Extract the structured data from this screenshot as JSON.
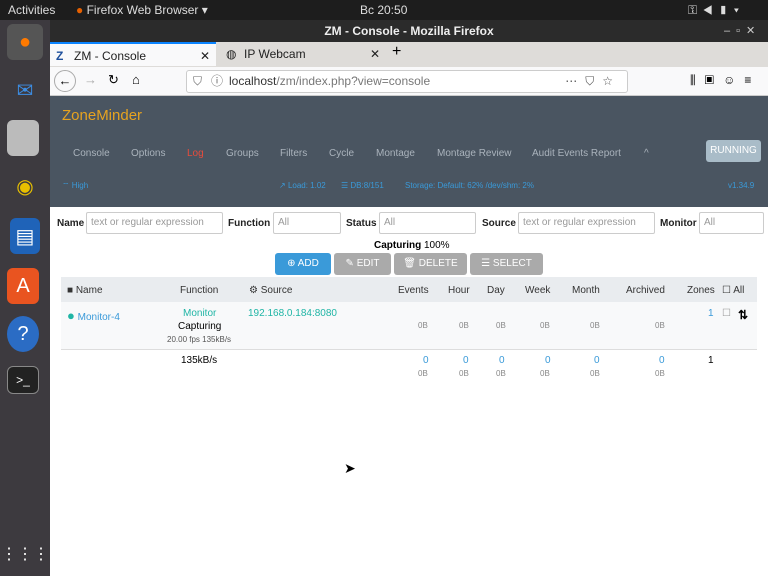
{
  "topbar": {
    "activities": "Activities",
    "app": "Firefox Web Browser ▾",
    "clock": "Bc 20:50"
  },
  "browser": {
    "window_title": "ZM - Console - Mozilla Firefox",
    "tabs": [
      {
        "label": "ZM - Console"
      },
      {
        "label": "IP Webcam"
      }
    ],
    "url_host": "localhost",
    "url_path": "/zm/index.php?view=console"
  },
  "zm": {
    "brand": "ZoneMinder",
    "nav": [
      "Console",
      "Options",
      "Log",
      "Groups",
      "Filters",
      "Cycle",
      "Montage",
      "Montage Review",
      "Audit Events Report",
      "^"
    ],
    "running": "RUNNING",
    "status": {
      "bandwidth": "High",
      "load": "Load: 1.02",
      "db": "DB:8/151",
      "storage": "Storage: Default: 62% /dev/shm: 2%",
      "version": "v1.34.9"
    }
  },
  "filters": {
    "name_label": "Name",
    "name_ph": "text or regular expression",
    "function_label": "Function",
    "function_val": "All",
    "status_label": "Status",
    "status_val": "All",
    "source_label": "Source",
    "source_ph": "text or regular expression",
    "monitor_label": "Monitor",
    "monitor_val": "All"
  },
  "capturing": {
    "label": "Capturing",
    "value": "100%"
  },
  "buttons": {
    "add": "ADD",
    "edit": "EDIT",
    "delete": "DELETE",
    "select": "SELECT"
  },
  "table": {
    "headers": [
      "Name",
      "Function",
      "Source",
      "Events",
      "Hour",
      "Day",
      "Week",
      "Month",
      "Archived",
      "Zones",
      "All"
    ],
    "row": {
      "name": "Monitor-4",
      "function": "Monitor",
      "state": "Capturing",
      "fps": "20.00 fps 135kB/s",
      "source": "192.168.0.184:8080",
      "sizes": [
        "0B",
        "0B",
        "0B",
        "0B",
        "0B",
        "0B"
      ],
      "zones": "1"
    },
    "totals": {
      "bandwidth": "135kB/s",
      "counts": [
        "0",
        "0",
        "0",
        "0",
        "0",
        "0"
      ],
      "sizes": [
        "0B",
        "0B",
        "0B",
        "0B",
        "0B",
        "0B"
      ],
      "zones": "1"
    }
  }
}
